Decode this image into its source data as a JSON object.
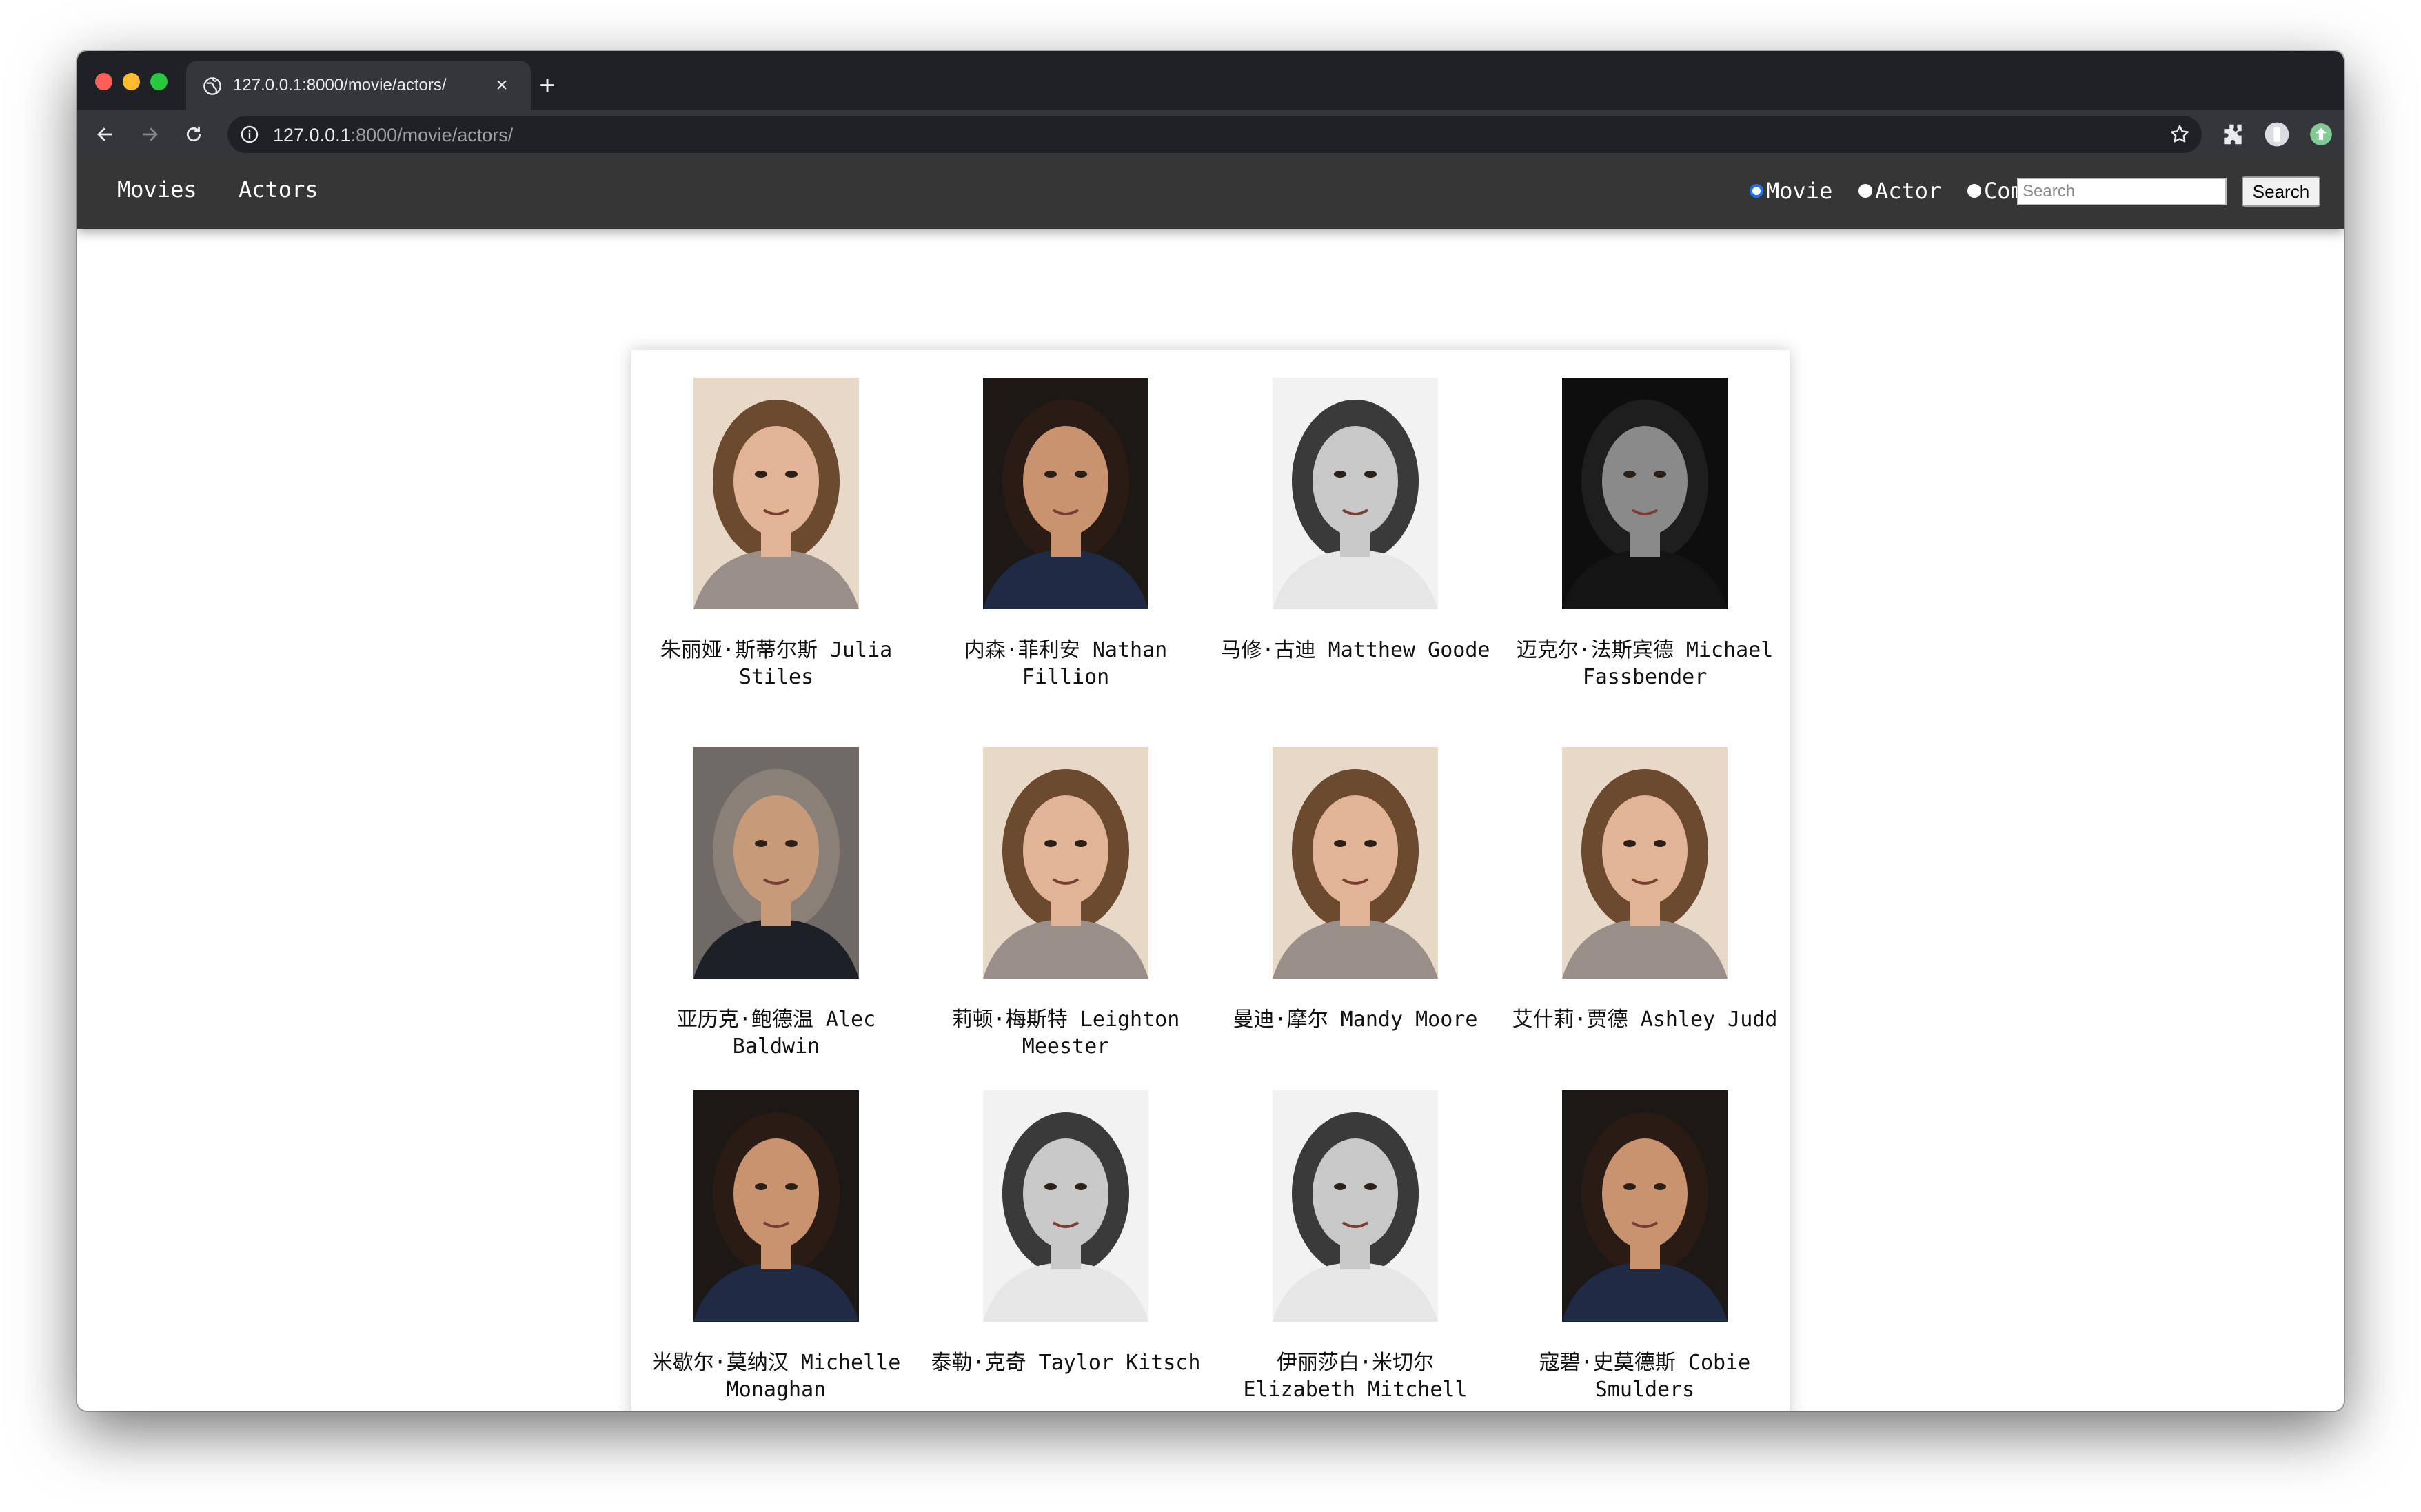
{
  "browser": {
    "tab_title": "127.0.0.1:8000/movie/actors/",
    "url_host": "127.0.0.1",
    "url_rest": ":8000/movie/actors/"
  },
  "navbar": {
    "links": [
      "Movies",
      "Actors"
    ],
    "search_options": [
      {
        "label": "Movie",
        "selected": true
      },
      {
        "label": "Actor",
        "selected": false
      },
      {
        "label": "Comment",
        "selected": false
      }
    ],
    "search_placeholder": "Search",
    "search_button": "Search"
  },
  "actors": [
    {
      "name": "朱丽娅·斯蒂尔斯 Julia Stiles",
      "palette": "warm-light"
    },
    {
      "name": "内森·菲利安 Nathan Fillion",
      "palette": "warm-dark"
    },
    {
      "name": "马修·古迪 Matthew Goode",
      "palette": "mono-light"
    },
    {
      "name": "迈克尔·法斯宾德 Michael Fassbender",
      "palette": "mono-dark"
    },
    {
      "name": "亚历克·鲍德温 Alec Baldwin",
      "palette": "warm-grey"
    },
    {
      "name": "莉顿·梅斯特 Leighton Meester",
      "palette": "warm-light"
    },
    {
      "name": "曼迪·摩尔 Mandy Moore",
      "palette": "warm-light"
    },
    {
      "name": "艾什莉·贾德 Ashley Judd",
      "palette": "warm-light"
    },
    {
      "name": "米歇尔·莫纳汉 Michelle Monaghan",
      "palette": "warm-dark"
    },
    {
      "name": "泰勒·克奇 Taylor Kitsch",
      "palette": "mono-light"
    },
    {
      "name": "伊丽莎白·米切尔 Elizabeth Mitchell",
      "palette": "mono-light"
    },
    {
      "name": "寇碧·史莫德斯 Cobie Smulders",
      "palette": "warm-dark"
    }
  ],
  "colors": {
    "navbar_bg": "#363636",
    "browser_frame": "#202124",
    "radio_selected": "#1a73e8"
  }
}
